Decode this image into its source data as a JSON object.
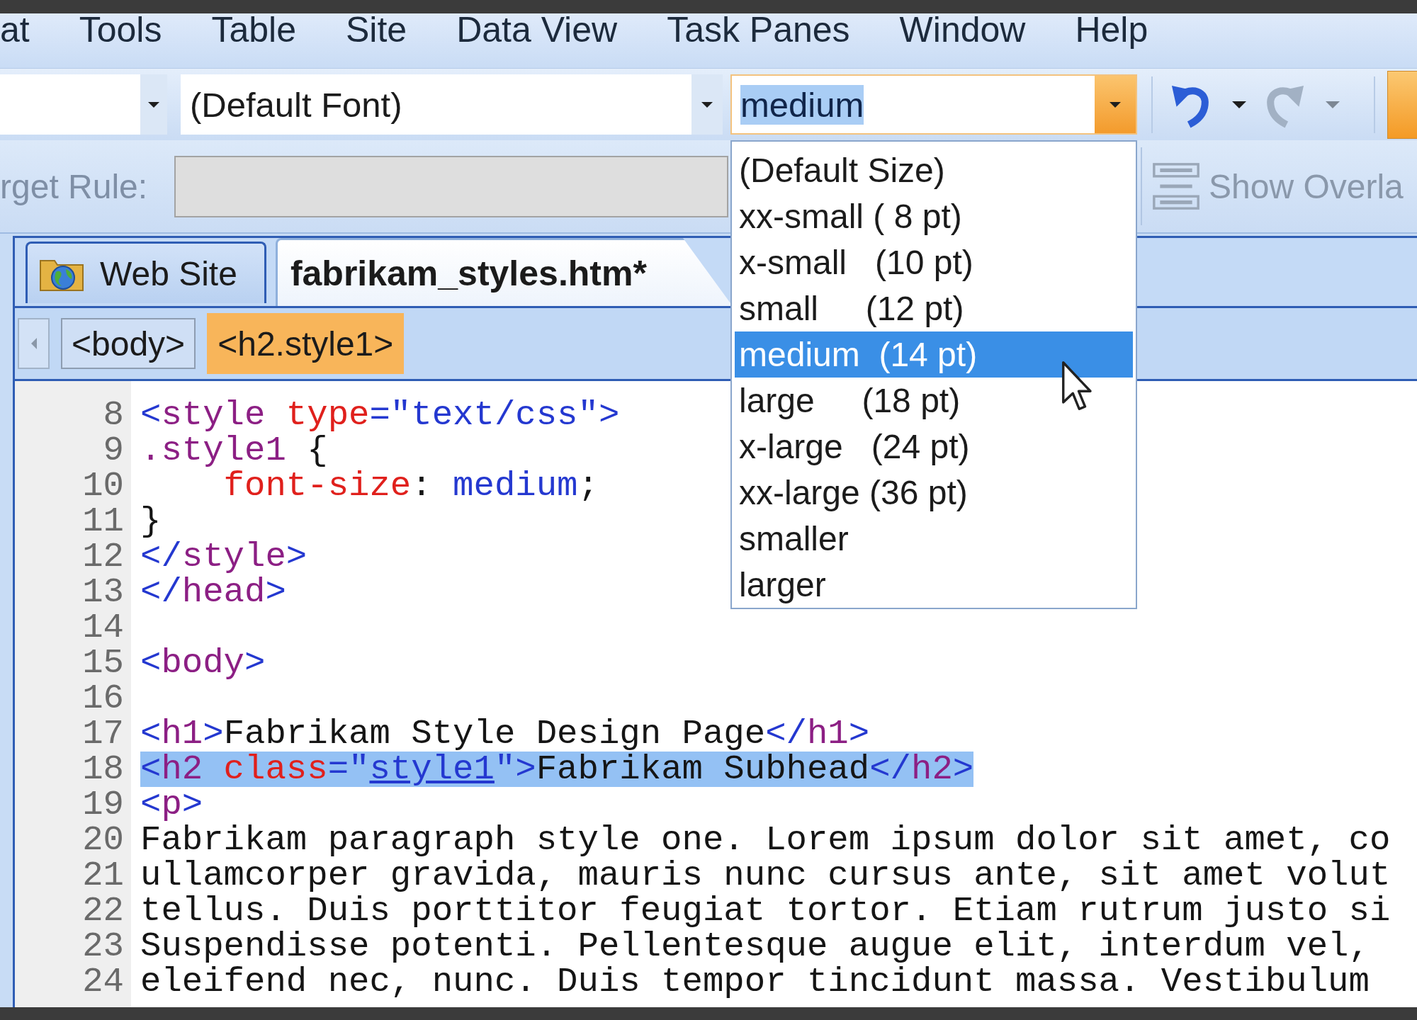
{
  "menu_bar": {
    "items": [
      "at",
      "Tools",
      "Table",
      "Site",
      "Data View",
      "Task Panes",
      "Window",
      "Help"
    ]
  },
  "toolbar": {
    "style_box": {
      "open": false
    },
    "font_box": {
      "value": "(Default Font)",
      "open": false
    },
    "size_box": {
      "value": "medium",
      "text_selected": true,
      "open": true
    },
    "history_buttons": [
      {
        "kind": "undo",
        "disabled": false
      },
      {
        "kind": "redo",
        "disabled": true
      }
    ],
    "format_button": {
      "on": true
    }
  },
  "size_dropdown": {
    "items": [
      {
        "label": "(Default Size)",
        "selected": false
      },
      {
        "label": "xx-small ( 8 pt)",
        "selected": false
      },
      {
        "label": "x-small   (10 pt)",
        "selected": false
      },
      {
        "label": "small     (12 pt)",
        "selected": false
      },
      {
        "label": "medium  (14 pt)",
        "selected": true
      },
      {
        "label": "large     (18 pt)",
        "selected": false
      },
      {
        "label": "x-large   (24 pt)",
        "selected": false
      },
      {
        "label": "xx-large (36 pt)",
        "selected": false
      },
      {
        "label": "smaller",
        "selected": false
      },
      {
        "label": "larger",
        "selected": false
      }
    ]
  },
  "style_bar": {
    "target_rule": {
      "label": "rget Rule:",
      "disabled": true
    },
    "show_overlay": {
      "label": "Show Overla",
      "disabled": true
    }
  },
  "tabs": [
    {
      "label": "Web Site",
      "kind": "site",
      "selected": false
    },
    {
      "label": "fabrikam_styles.htm*",
      "kind": "file",
      "selected": true
    }
  ],
  "breadcrumb": [
    {
      "label": "<body>",
      "selected": false
    },
    {
      "label": "<h2.style1>",
      "selected": true
    }
  ],
  "code": {
    "lines": [
      {
        "number": "8",
        "selected": false,
        "tokens": [
          {
            "kind": "bracket",
            "text": "<"
          },
          {
            "kind": "tag",
            "text": "style"
          },
          {
            "kind": "attr",
            "text": " type"
          },
          {
            "kind": "value",
            "text": "=\"text/css\">"
          }
        ]
      },
      {
        "number": "9",
        "selected": false,
        "tokens": [
          {
            "kind": "selector",
            "text": ".style1"
          },
          {
            "kind": "punct",
            "text": " {"
          }
        ]
      },
      {
        "number": "10",
        "selected": false,
        "tokens": [
          {
            "kind": "property",
            "text": "    font-size"
          },
          {
            "kind": "punct",
            "text": ": "
          },
          {
            "kind": "value",
            "text": "medium"
          },
          {
            "kind": "punct",
            "text": ";"
          }
        ]
      },
      {
        "number": "11",
        "selected": false,
        "tokens": [
          {
            "kind": "punct",
            "text": "}"
          }
        ]
      },
      {
        "number": "12",
        "selected": false,
        "tokens": [
          {
            "kind": "bracket",
            "text": "</"
          },
          {
            "kind": "tag",
            "text": "style"
          },
          {
            "kind": "bracket",
            "text": ">"
          }
        ]
      },
      {
        "number": "13",
        "selected": false,
        "tokens": [
          {
            "kind": "bracket",
            "text": "</"
          },
          {
            "kind": "tag",
            "text": "head"
          },
          {
            "kind": "bracket",
            "text": ">"
          }
        ]
      },
      {
        "number": "14"
      },
      {
        "number": "15",
        "selected": false,
        "tokens": [
          {
            "kind": "bracket",
            "text": "<"
          },
          {
            "kind": "tag",
            "text": "body"
          },
          {
            "kind": "bracket",
            "text": ">"
          }
        ]
      },
      {
        "number": "16"
      },
      {
        "number": "17",
        "selected": false,
        "tokens": [
          {
            "kind": "bracket",
            "text": "<"
          },
          {
            "kind": "tag",
            "text": "h1"
          },
          {
            "kind": "bracket",
            "text": ">"
          },
          {
            "kind": "text",
            "text": "Fabrikam Style Design Page"
          },
          {
            "kind": "bracket",
            "text": "</"
          },
          {
            "kind": "tag",
            "text": "h1"
          },
          {
            "kind": "bracket",
            "text": ">"
          }
        ]
      },
      {
        "number": "18",
        "selected": true,
        "tokens": [
          {
            "kind": "bracket",
            "text": "<"
          },
          {
            "kind": "tag",
            "text": "h2"
          },
          {
            "kind": "attr",
            "text": " class"
          },
          {
            "kind": "value",
            "text": "=\""
          },
          {
            "kind": "link",
            "text": "style1"
          },
          {
            "kind": "value",
            "text": "\">"
          },
          {
            "kind": "text",
            "text": "Fabrikam Subhead"
          },
          {
            "kind": "bracket",
            "text": "</"
          },
          {
            "kind": "tag",
            "text": "h2"
          },
          {
            "kind": "bracket",
            "text": ">"
          }
        ]
      },
      {
        "number": "19",
        "selected": false,
        "tokens": [
          {
            "kind": "bracket",
            "text": "<"
          },
          {
            "kind": "tag",
            "text": "p"
          },
          {
            "kind": "bracket",
            "text": ">"
          }
        ]
      },
      {
        "number": "20",
        "selected": false,
        "tokens": [
          {
            "kind": "text",
            "text": "Fabrikam paragraph style one. Lorem ipsum dolor sit amet, co"
          }
        ]
      },
      {
        "number": "21",
        "selected": false,
        "tokens": [
          {
            "kind": "text",
            "text": "ullamcorper gravida, mauris nunc cursus ante, sit amet volut"
          }
        ]
      },
      {
        "number": "22",
        "selected": false,
        "tokens": [
          {
            "kind": "text",
            "text": "tellus. Duis porttitor feugiat tortor. Etiam rutrum justo si"
          }
        ]
      },
      {
        "number": "23",
        "selected": false,
        "tokens": [
          {
            "kind": "text",
            "text": "Suspendisse potenti. Pellentesque augue elit, interdum vel,"
          }
        ]
      },
      {
        "number": "24",
        "selected": false,
        "tokens": [
          {
            "kind": "text",
            "text": "eleifend nec, nunc. Duis tempor tincidunt massa. Vestibulum"
          }
        ]
      }
    ]
  }
}
